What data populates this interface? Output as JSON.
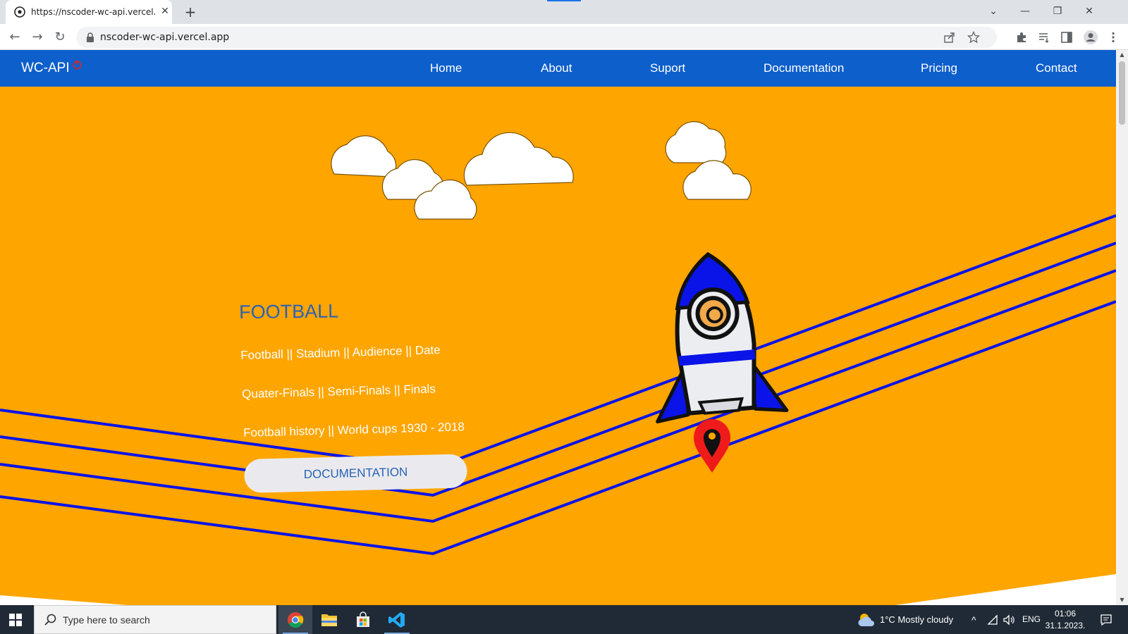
{
  "browser": {
    "tab_title": "https://nscoder-wc-api.vercel.app",
    "tab_close": "✕",
    "new_tab": "+",
    "url": "nscoder-wc-api.vercel.app",
    "nav": {
      "back": "←",
      "forward": "→",
      "reload": "↻"
    },
    "window_controls": {
      "tab_list": "⌄",
      "minimize": "—",
      "restore": "❐",
      "close": "✕"
    },
    "icons": [
      "share-icon",
      "star-icon",
      "extensions-icon",
      "reading-list-icon",
      "side-panel-icon",
      "profile-icon",
      "menu-icon"
    ]
  },
  "site": {
    "brand": "WC-API",
    "nav_links": [
      "Home",
      "About",
      "Suport",
      "Documentation",
      "Pricing",
      "Contact"
    ],
    "hero": {
      "title": "FOOTBALL",
      "lines": [
        "Football || Stadium || Audience || Date",
        "Quater-Finals || Semi-Finals || Finals",
        "Football history || World cups 1930 - 2018"
      ],
      "cta": "DOCUMENTATION"
    },
    "colors": {
      "background": "#ffa500",
      "nav": "#0d5fcc",
      "lines": "#0a14e8",
      "title": "#2a62b5"
    }
  },
  "taskbar": {
    "search_placeholder": "Type here to search",
    "apps": [
      "chrome-icon",
      "file-explorer-icon",
      "store-icon",
      "vscode-icon"
    ],
    "weather": "1°C  Mostly cloudy",
    "language": "ENG",
    "time": "01:06",
    "date": "31.1.2023."
  }
}
